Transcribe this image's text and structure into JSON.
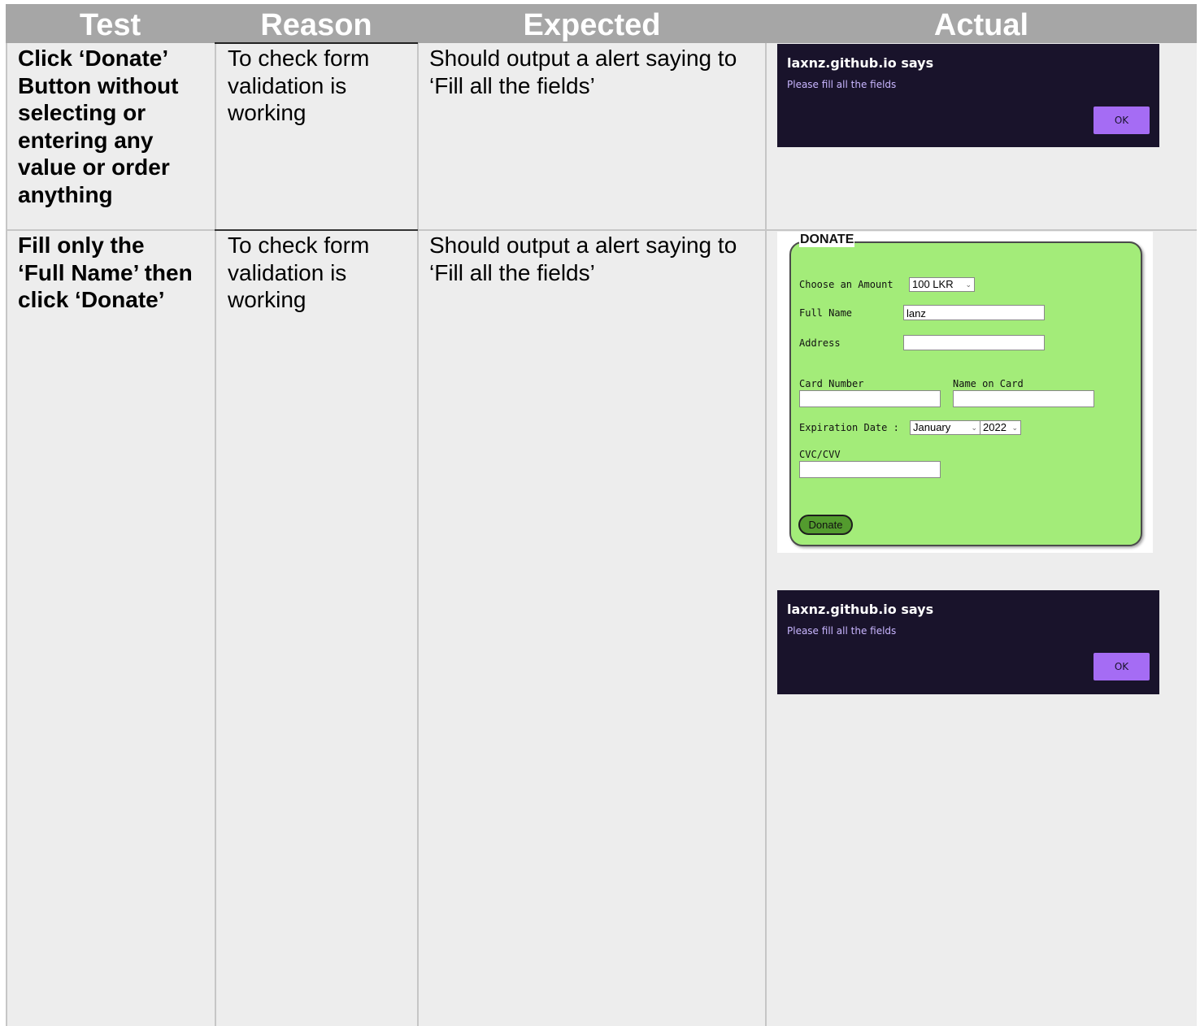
{
  "headers": {
    "test": "Test",
    "reason": "Reason",
    "expected": "Expected",
    "actual": "Actual"
  },
  "rows": [
    {
      "test": [
        "Click ‘Donate’",
        "Button without",
        "selecting or",
        "entering any",
        "value or order",
        "anything"
      ],
      "reason": [
        "To check form",
        "validation is",
        "working"
      ],
      "expected": [
        "Should output a alert saying to",
        "‘Fill all the fields’"
      ]
    },
    {
      "test": [
        "Fill only the",
        "‘Full Name’ then",
        "click ‘Donate’"
      ],
      "reason": [
        "To check form",
        "validation is",
        "working"
      ],
      "expected": [
        "Should output a alert saying to",
        "‘Fill all the fields’"
      ]
    }
  ],
  "alert": {
    "title": "laxnz.github.io says",
    "message": "Please fill all the fields",
    "ok_label": "OK"
  },
  "form": {
    "legend": "DONATE",
    "amount_label": "Choose an Amount",
    "amount_value": "100 LKR",
    "fullname_label": "Full Name",
    "fullname_value": "lanz",
    "address_label": "Address",
    "address_value": "",
    "card_number_label": "Card Number",
    "name_on_card_label": "Name on Card",
    "expiration_label": "Expiration Date :",
    "month_value": "January",
    "year_value": "2022",
    "cvc_label": "CVC/CVV",
    "donate_label": "Donate"
  },
  "colors": {
    "header_bg": "#a6a6a6",
    "cell_bg": "#ededed",
    "alert_bg": "#19132b",
    "ok_bg": "#a56cf4",
    "form_bg": "#a3ec79",
    "donate_btn": "#539b2e"
  }
}
